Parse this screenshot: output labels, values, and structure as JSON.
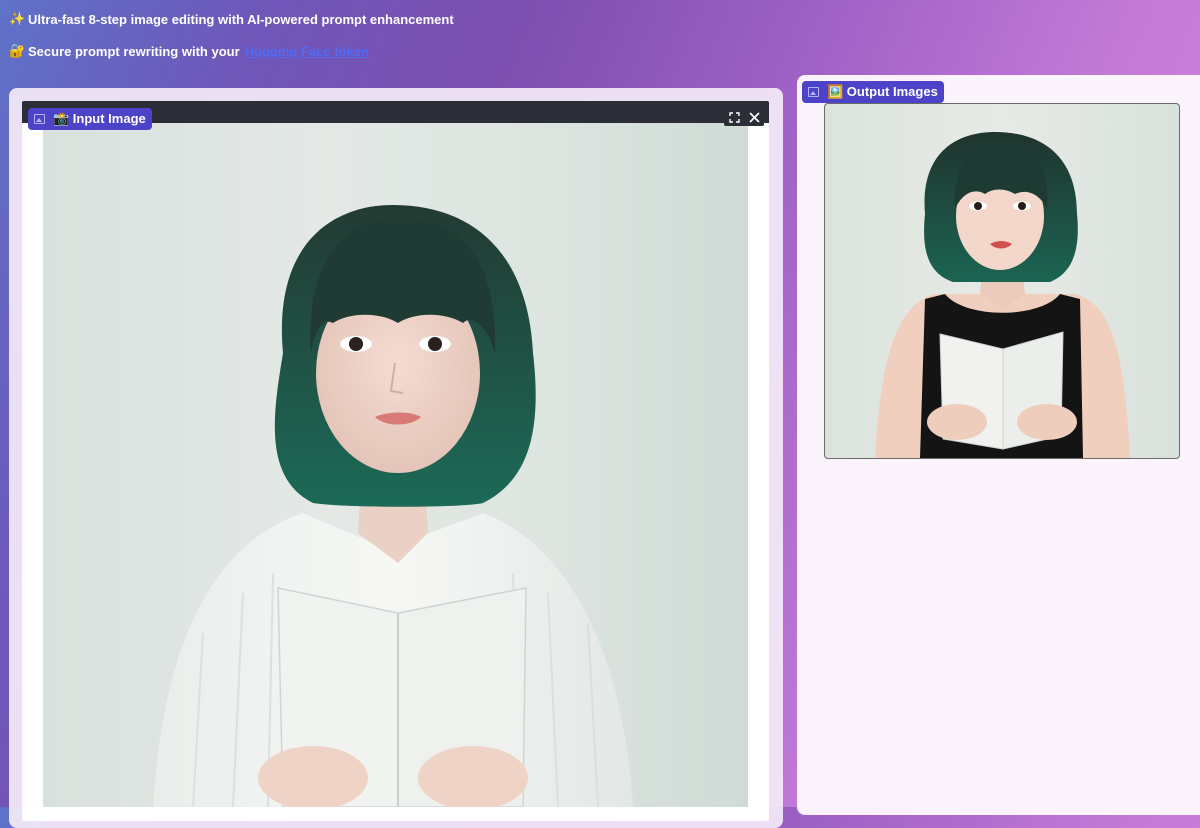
{
  "header": {
    "line1_emoji": "✨",
    "line1_text": "Ultra-fast 8-step image editing with AI-powered prompt enhancement",
    "line2_emoji": "🔐",
    "line2_text": "Secure prompt rewriting with your",
    "line2_link": "Hugging Face token"
  },
  "input_panel": {
    "label": "📸 Input Image",
    "label_icon": "image-icon",
    "toolbar": {
      "fullscreen_icon": "fullscreen-icon",
      "close_icon": "close-icon"
    },
    "photo_description_icon": "portrait-photo"
  },
  "output_panel": {
    "label": "🖼️ Output Images",
    "label_icon": "image-icon"
  },
  "colors": {
    "accent": "#4c43c8",
    "link": "#4f6af5",
    "toolbar_bg": "#2b2e36"
  }
}
